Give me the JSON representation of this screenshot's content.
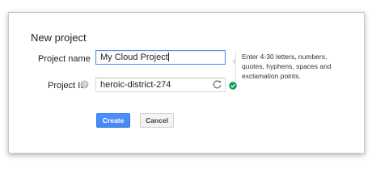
{
  "dialog": {
    "title": "New project",
    "project_name": {
      "label": "Project name",
      "value": "My Cloud Project"
    },
    "project_id": {
      "label": "Project ID",
      "value": "heroic-district-274"
    },
    "hint": "Enter 4-30 letters, numbers, quotes, hyphens, spaces and exclamation points.",
    "buttons": {
      "create": "Create",
      "cancel": "Cancel"
    }
  },
  "icons": {
    "help": "help-icon",
    "refresh": "refresh-icon",
    "valid": "check-circle-icon"
  },
  "colors": {
    "primary_button": "#4d90fe",
    "focus_border": "#4d90fe",
    "valid_check": "#0f9d58"
  }
}
